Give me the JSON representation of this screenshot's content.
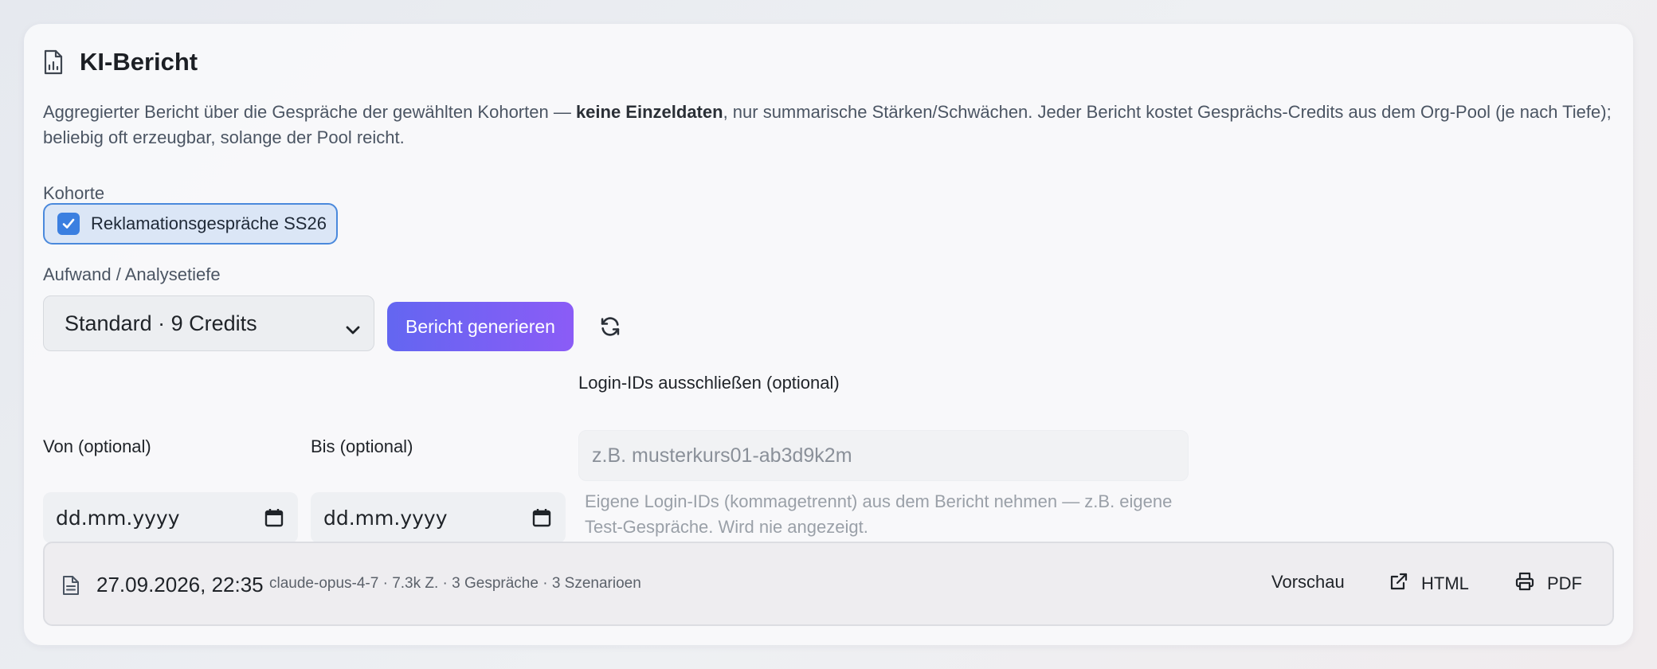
{
  "header": {
    "title": "KI-Bericht",
    "icon": "report-chart-icon"
  },
  "description": {
    "part1": "Aggregierter Bericht über die Gespräche der gewählten Kohorten — ",
    "bold": "keine Einzeldaten",
    "part2": ", nur summarische Stärken/Schwächen. Jeder Bericht kostet Gesprächs-Credits aus dem Org-Pool (je nach Tiefe); beliebig oft erzeugbar, solange der Pool reicht."
  },
  "cohort": {
    "label": "Kohorte",
    "items": [
      {
        "label": "Reklamationsgespräche SS26",
        "checked": true
      }
    ]
  },
  "effort": {
    "label": "Aufwand / Analysetiefe",
    "selected": "Standard · 9 Credits",
    "generate_label": "Bericht generieren"
  },
  "date_from": {
    "label": "Von (optional)",
    "placeholder": "dd.mm.yyyy"
  },
  "date_to": {
    "label": "Bis (optional)",
    "placeholder": "dd.mm.yyyy"
  },
  "exclude": {
    "label": "Login-IDs ausschließen (optional)",
    "placeholder": "z.B. musterkurs01-ab3d9k2m",
    "value": "",
    "hint": "Eigene Login-IDs (kommagetrennt) aus dem Bericht nehmen — z.B. eigene Test-Gespräche. Wird nie angezeigt."
  },
  "report": {
    "date": "27.09.2026, 22:35",
    "meta": "claude-opus-4-7 · 7.3k Z. · 3 Gespräche · 3 Szenarioen",
    "preview_label": "Vorschau",
    "html_label": "HTML",
    "pdf_label": "PDF"
  },
  "colors": {
    "accent_start": "#6366f1",
    "accent_end": "#8b5cf6",
    "checkbox": "#3b7fe0"
  }
}
